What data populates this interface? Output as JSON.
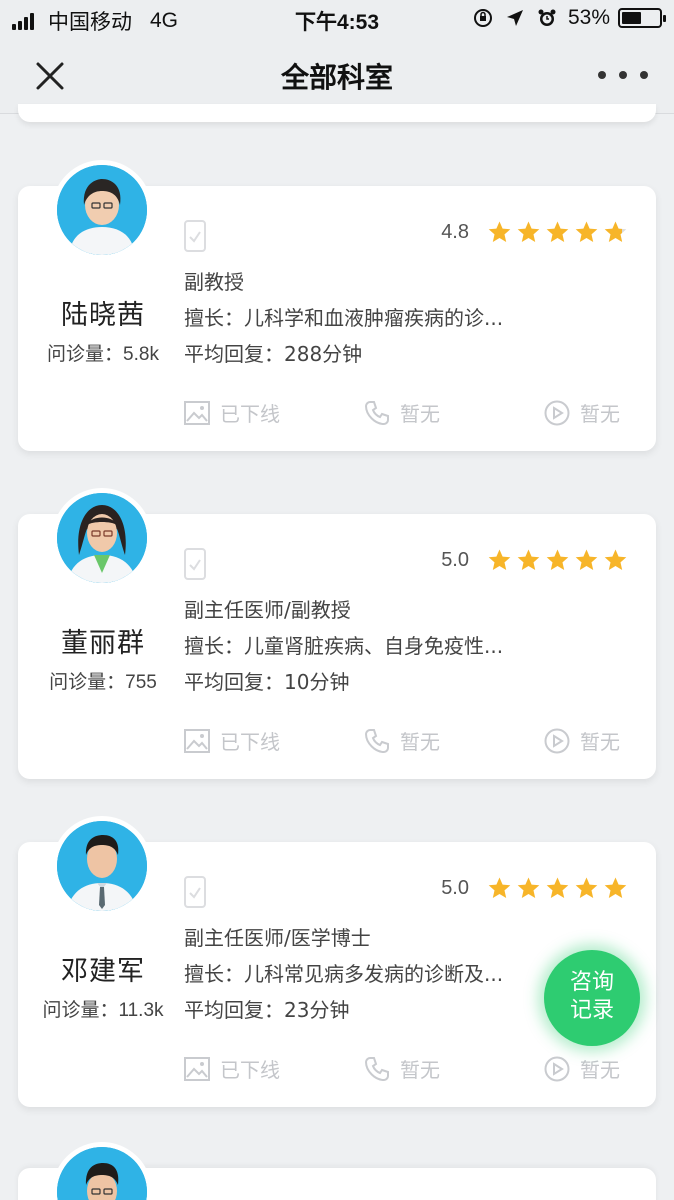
{
  "status_bar": {
    "carrier": "中国移动",
    "network": "4G",
    "time": "下午4:53",
    "battery_percent": "53%",
    "battery_level": 0.53
  },
  "nav": {
    "title": "全部科室",
    "close_icon": "close-icon",
    "more_icon": "more-dots-icon"
  },
  "colors": {
    "star": "#f7b529",
    "star_empty": "#dcdcdc",
    "fab": "#2ecc71",
    "avatar_bg": "#2fb3e6",
    "disabled_text": "#c4c6ca"
  },
  "doctors": [
    {
      "name": "陆晓茜",
      "consult_count": "问诊量：5.8k",
      "rating": "4.8",
      "stars": 4.8,
      "title": "副教授",
      "expertise": "擅长：儿科学和血液肿瘤疾病的诊...",
      "avg_reply": "平均回复：288分钟",
      "actions": [
        "已下线",
        "暂无",
        "暂无"
      ]
    },
    {
      "name": "董丽群",
      "consult_count": "问诊量：755",
      "rating": "5.0",
      "stars": 5.0,
      "title": "副主任医师/副教授",
      "expertise": "擅长：儿童肾脏疾病、自身免疫性...",
      "avg_reply": "平均回复：10分钟",
      "actions": [
        "已下线",
        "暂无",
        "暂无"
      ]
    },
    {
      "name": "邓建军",
      "consult_count": "问诊量：11.3k",
      "rating": "5.0",
      "stars": 5.0,
      "title": "副主任医师/医学博士",
      "expertise": "擅长：儿科常见病多发病的诊断及...",
      "avg_reply": "平均回复：23分钟",
      "actions": [
        "已下线",
        "暂无",
        "暂无"
      ]
    }
  ],
  "fab": {
    "line1": "咨询",
    "line2": "记录"
  }
}
